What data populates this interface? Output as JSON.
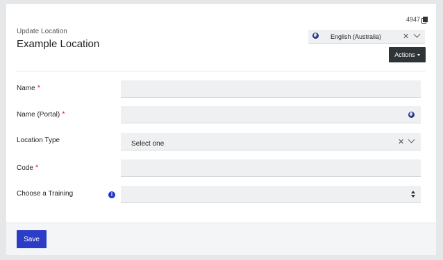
{
  "header": {
    "record_id": "4947",
    "subtitle": "Update Location",
    "title": "Example Location",
    "language": "English (Australia)",
    "actions_label": "Actions"
  },
  "form": {
    "fields": [
      {
        "label": "Name",
        "required": true,
        "value": ""
      },
      {
        "label": "Name (Portal)",
        "required": true,
        "value": ""
      },
      {
        "label": "Location Type",
        "required": false,
        "value": "Select one"
      },
      {
        "label": "Code",
        "required": true,
        "value": ""
      },
      {
        "label": "Choose a Training",
        "required": false,
        "value": ""
      }
    ],
    "required_marker": "*",
    "info_glyph": "i"
  },
  "footer": {
    "save_label": "Save"
  },
  "colors": {
    "primary": "#2b3cc6",
    "dark_button": "#2f3436",
    "required": "#d9232d"
  }
}
